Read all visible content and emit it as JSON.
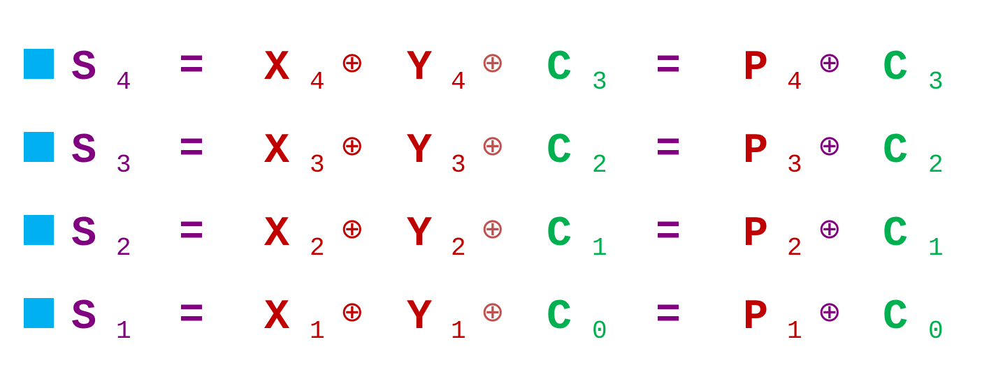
{
  "colors": {
    "bullet": "#00b0f0",
    "sum": "#800080",
    "input": "#c00000",
    "xor_y": "#c0504d",
    "carry": "#00b050",
    "equals": "#800080",
    "xor_p": "#800080"
  },
  "equations": [
    {
      "s": "S",
      "s_sub": "4",
      "eq1": "=",
      "x": "X",
      "x_sub": "4",
      "xor1": "⊕",
      "y": "Y",
      "y_sub": "4",
      "xor2": "⊕",
      "c1": "C",
      "c1_sub": "3",
      "eq2": "=",
      "p": "P",
      "p_sub": "4",
      "xor3": "⊕",
      "c2": "C",
      "c2_sub": "3"
    },
    {
      "s": "S",
      "s_sub": "3",
      "eq1": "=",
      "x": "X",
      "x_sub": "3",
      "xor1": "⊕",
      "y": "Y",
      "y_sub": "3",
      "xor2": "⊕",
      "c1": "C",
      "c1_sub": "2",
      "eq2": "=",
      "p": "P",
      "p_sub": "3",
      "xor3": "⊕",
      "c2": "C",
      "c2_sub": "2"
    },
    {
      "s": "S",
      "s_sub": "2",
      "eq1": "=",
      "x": "X",
      "x_sub": "2",
      "xor1": "⊕",
      "y": "Y",
      "y_sub": "2",
      "xor2": "⊕",
      "c1": "C",
      "c1_sub": "1",
      "eq2": "=",
      "p": "P",
      "p_sub": "2",
      "xor3": "⊕",
      "c2": "C",
      "c2_sub": "1"
    },
    {
      "s": "S",
      "s_sub": "1",
      "eq1": "=",
      "x": "X",
      "x_sub": "1",
      "xor1": "⊕",
      "y": "Y",
      "y_sub": "1",
      "xor2": "⊕",
      "c1": "C",
      "c1_sub": "0",
      "eq2": "=",
      "p": "P",
      "p_sub": "1",
      "xor3": "⊕",
      "c2": "C",
      "c2_sub": "0"
    }
  ]
}
